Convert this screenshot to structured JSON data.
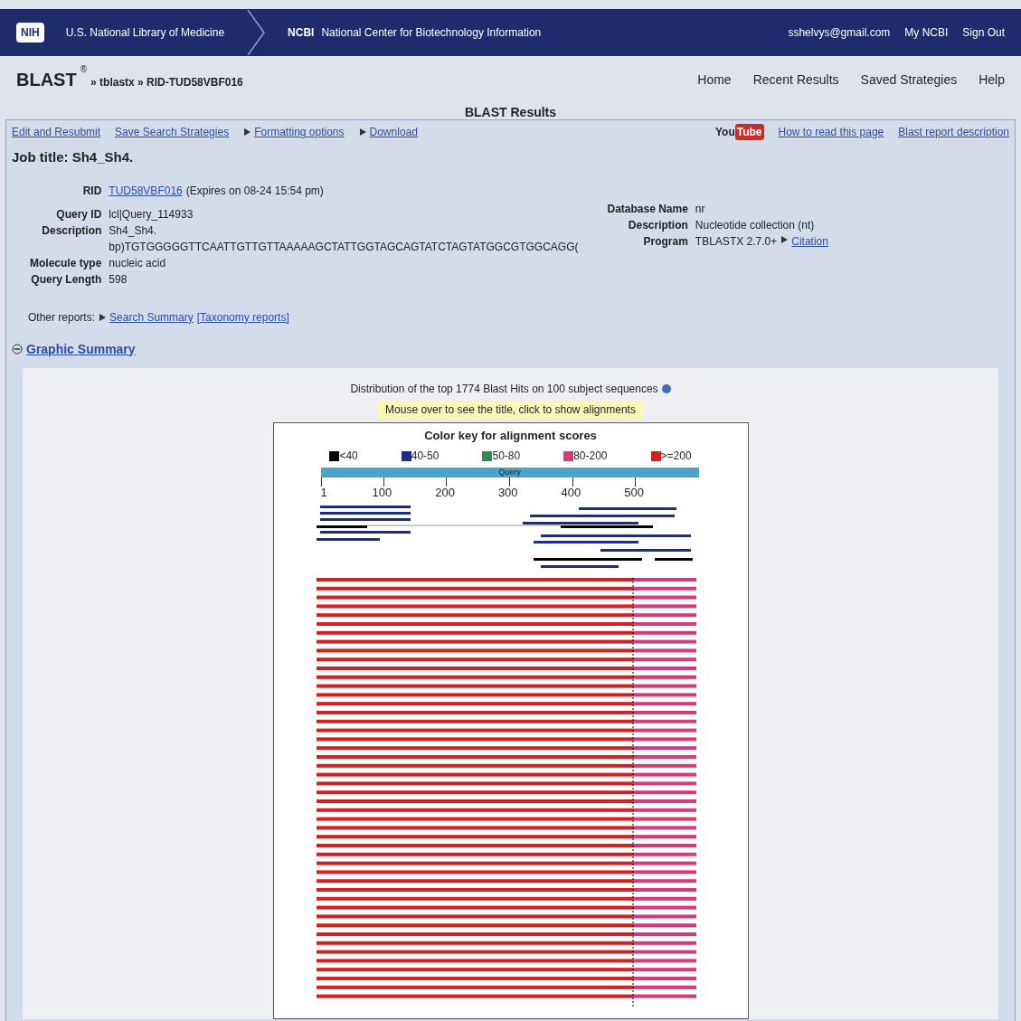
{
  "header": {
    "nih_logo": "NIH",
    "library": "U.S. National Library of Medicine",
    "ncbi_abbr": "NCBI",
    "ncbi_name": "National Center for Biotechnology Information",
    "user": "sshelvys@gmail.com",
    "links": [
      "My NCBI",
      "Sign Out"
    ]
  },
  "breadcrumb": {
    "app": "BLAST",
    "reg": "®",
    "path": "» tblastx » RID-TUD58VBF016"
  },
  "nav": [
    "Home",
    "Recent Results",
    "Saved Strategies",
    "Help"
  ],
  "page_title": "BLAST Results",
  "toolbar": {
    "links": [
      {
        "label": "Edit and Resubmit",
        "arrow": false
      },
      {
        "label": "Save Search Strategies",
        "arrow": false
      },
      {
        "label": "Formatting options",
        "arrow": true
      },
      {
        "label": "Download",
        "arrow": true
      }
    ],
    "youtube": [
      "You",
      "Tube"
    ],
    "help_links": [
      "How to read this page",
      "Blast report description"
    ]
  },
  "job_title": "Job title: Sh4_Sh4.",
  "rid": {
    "label": "RID",
    "value": "TUD58VBF016",
    "note": "(Expires on 08-24 15:54 pm)"
  },
  "query_fields": [
    {
      "label": "Query ID",
      "value": "lcl|Query_114933"
    },
    {
      "label": "Description",
      "value": "Sh4_Sh4."
    },
    {
      "value": "bp)TGTGGGGGTTCAATTGTTGTTAAAAAGCTATTGGTAGCAGTATCTAGTATGGCGTGGCAGG("
    },
    {
      "label": "Molecule type",
      "value": "nucleic acid"
    },
    {
      "label": "Query Length",
      "value": "598"
    }
  ],
  "db_fields": [
    {
      "label": "Database Name",
      "value": "nr"
    },
    {
      "label": "Description",
      "value": "Nucleotide collection (nt)"
    },
    {
      "label": "Program",
      "value": "TBLASTX 2.7.0+",
      "link": "Citation"
    }
  ],
  "other_reports": {
    "label": "Other reports:",
    "links": [
      "Search Summary",
      "[Taxonomy reports]"
    ]
  },
  "graphic_summary": {
    "title": "Graphic Summary",
    "expanded": true,
    "distribution": "Distribution of the top 1774 Blast Hits on 100 subject sequences",
    "hint": "Mouse over to see the title, click to show alignments",
    "color_key_title": "Color key for alignment scores",
    "legend": [
      {
        "label": "<40",
        "color": "#000000"
      },
      {
        "label": "40-50",
        "color": "#1a2c8a"
      },
      {
        "label": "50-80",
        "color": "#2e8b57"
      },
      {
        "label": "80-200",
        "color": "#d63a7a"
      },
      {
        "label": ">=200",
        "color": "#d42020"
      }
    ],
    "query_label": "Query",
    "ticks": [
      "1",
      "100",
      "200",
      "300",
      "400",
      "500"
    ]
  }
}
